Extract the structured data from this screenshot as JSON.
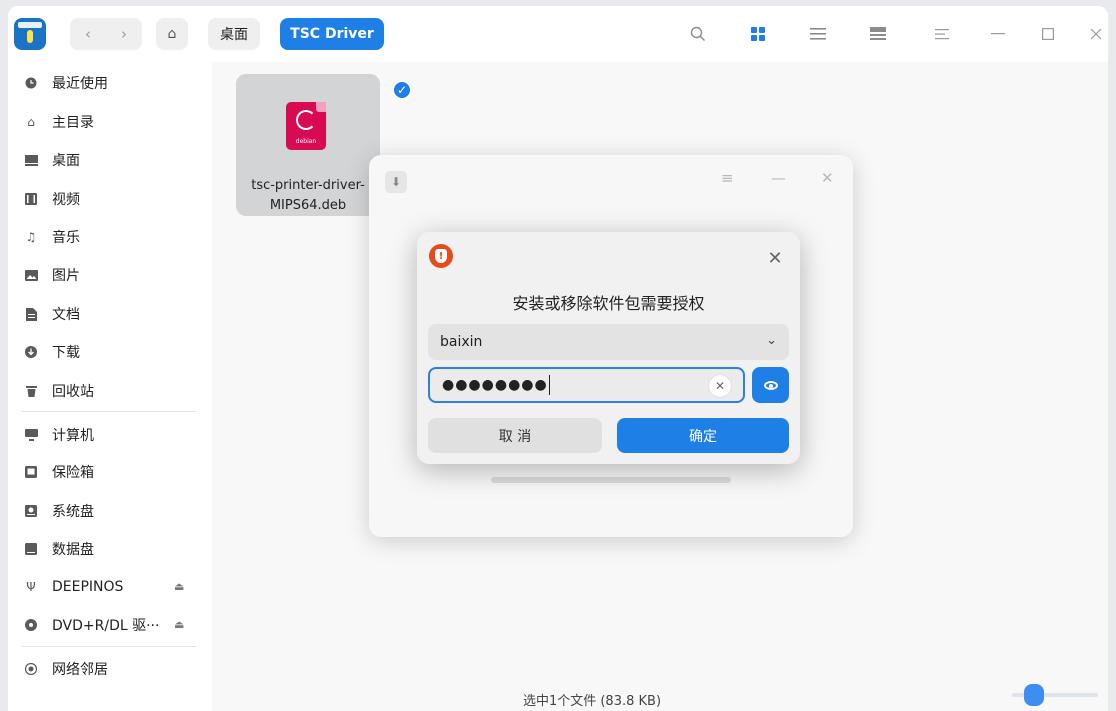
{
  "titlebar": {
    "nav_back": "‹",
    "nav_forward": "›",
    "home_icon": "home-icon",
    "breadcrumbs": [
      "桌面",
      "TSC Driver"
    ],
    "icons": [
      "search-icon",
      "icon-view-icon",
      "list-view-icon",
      "tree-view-icon",
      "menu-icon",
      "minimize-icon",
      "maximize-icon",
      "close-icon"
    ],
    "accent": "#1e7fe6"
  },
  "sidebar": {
    "items": [
      {
        "label": "最近使用",
        "icon": "clock-icon"
      },
      {
        "label": "主目录",
        "icon": "home-icon"
      },
      {
        "label": "桌面",
        "icon": "desktop-icon"
      },
      {
        "label": "视频",
        "icon": "video-icon"
      },
      {
        "label": "音乐",
        "icon": "music-icon"
      },
      {
        "label": "图片",
        "icon": "image-icon"
      },
      {
        "label": "文档",
        "icon": "document-icon"
      },
      {
        "label": "下载",
        "icon": "download-icon"
      },
      {
        "label": "回收站",
        "icon": "trash-icon"
      }
    ],
    "devices": [
      {
        "label": "计算机",
        "icon": "computer-icon"
      },
      {
        "label": "保险箱",
        "icon": "vault-icon"
      },
      {
        "label": "系统盘",
        "icon": "system-disk-icon"
      },
      {
        "label": "数据盘",
        "icon": "data-disk-icon"
      },
      {
        "label": "DEEPINOS",
        "icon": "usb-icon"
      },
      {
        "label": "DVD+R/DL 驱···",
        "icon": "disc-icon"
      }
    ],
    "network": [
      {
        "label": "网络邻居",
        "icon": "network-icon"
      }
    ]
  },
  "content": {
    "file": {
      "name": "tsc-printer-driver-MIPS64.deb",
      "icon_label": "debian",
      "selected": true
    },
    "status": "选中1个文件 (83.8 KB)"
  },
  "auth_dialog": {
    "title": "安装或移除软件包需要授权",
    "user": "baixin",
    "password_mask": "●●●●●●●●",
    "cancel": "取 消",
    "confirm": "确定",
    "warning_color": "#e84b1a"
  }
}
